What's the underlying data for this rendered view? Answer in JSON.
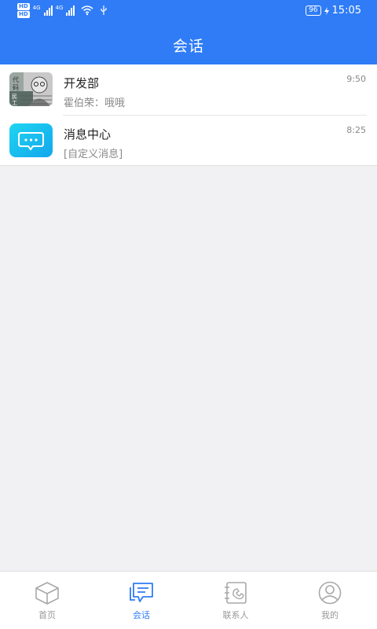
{
  "status_bar": {
    "hd1": "HD",
    "hd2": "HD",
    "net1": "4G",
    "net2": "4G",
    "battery": "96",
    "time": "15:05"
  },
  "header": {
    "title": "会话"
  },
  "conversations": [
    {
      "name": "开发部",
      "preview": "霍伯荣：哦哦",
      "time": "9:50",
      "avatar_icon": "group-avatar-icon"
    },
    {
      "name": "消息中心",
      "preview": "[自定义消息]",
      "time": "8:25",
      "avatar_icon": "message-center-icon"
    }
  ],
  "tabs": [
    {
      "label": "首页",
      "icon": "home-box-icon"
    },
    {
      "label": "会话",
      "icon": "chat-icon",
      "active": true
    },
    {
      "label": "联系人",
      "icon": "contacts-book-icon"
    },
    {
      "label": "我的",
      "icon": "profile-icon"
    }
  ],
  "colors": {
    "primary": "#2f7cf6",
    "background": "#f1f0f3",
    "inactive_tab": "#999999"
  }
}
